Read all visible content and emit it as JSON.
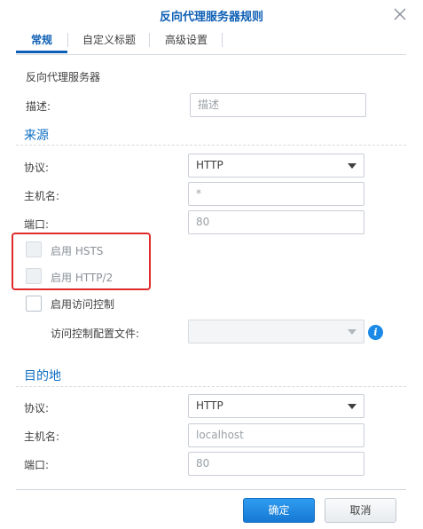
{
  "dialog": {
    "title": "反向代理服务器规则",
    "close_icon": "close-icon"
  },
  "tabs": [
    {
      "label": "常规",
      "active": true
    },
    {
      "label": "自定义标题",
      "active": false
    },
    {
      "label": "高级设置",
      "active": false
    }
  ],
  "general": {
    "section_label": "反向代理服务器",
    "description_label": "描述:",
    "description_placeholder": "描述"
  },
  "source": {
    "title": "来源",
    "protocol_label": "协议:",
    "protocol_value": "HTTP",
    "hostname_label": "主机名:",
    "hostname_value": "*",
    "port_label": "端口:",
    "port_value": "80",
    "hsts_label": "启用 HSTS",
    "hsts_checked": false,
    "http2_label": "启用 HTTP/2",
    "http2_checked": false,
    "access_control_label": "启用访问控制",
    "access_control_checked": false,
    "access_profile_label": "访问控制配置文件:",
    "access_profile_value": ""
  },
  "destination": {
    "title": "目的地",
    "protocol_label": "协议:",
    "protocol_value": "HTTP",
    "hostname_label": "主机名:",
    "hostname_placeholder": "localhost",
    "port_label": "端口:",
    "port_placeholder": "80"
  },
  "footer": {
    "ok_label": "确定",
    "cancel_label": "取消"
  },
  "colors": {
    "accent": "#0e5fb5",
    "highlight_box": "#e02b2b",
    "primary_button": "#1a8ae6"
  }
}
